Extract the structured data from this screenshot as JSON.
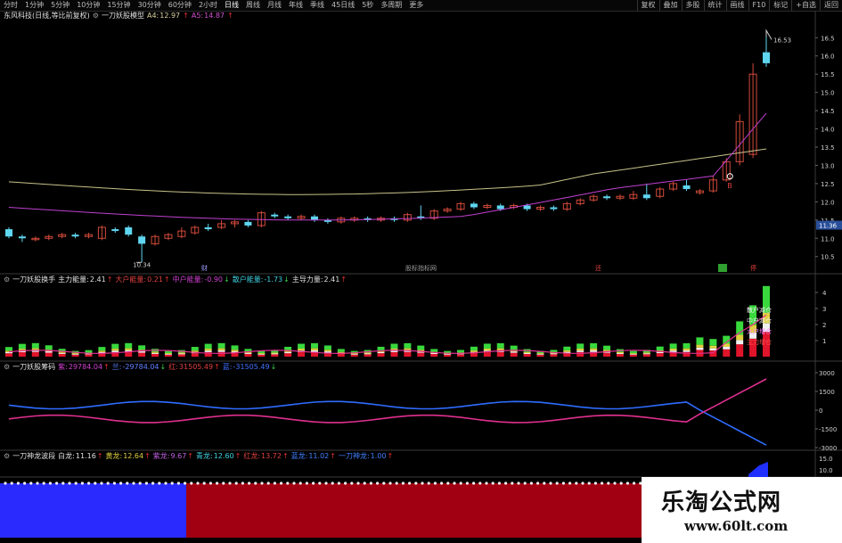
{
  "toolbar": {
    "tabs": [
      "分时",
      "1分钟",
      "5分钟",
      "10分钟",
      "15分钟",
      "30分钟",
      "60分钟",
      "2小时",
      "日线",
      "周线",
      "月线",
      "年线",
      "季线",
      "45日线",
      "5秒",
      "多周期",
      "更多"
    ],
    "active_tab": "日线",
    "right_buttons": [
      "复权",
      "叠加",
      "多股",
      "统计",
      "画线",
      "F10",
      "标记",
      "+自选",
      "返回"
    ]
  },
  "price_panel": {
    "stock": "东风科技(日线,等比前复权)",
    "indicator": "一刀妖股模型",
    "a4_label": "A4:",
    "a4_value": "12.97",
    "a5_label": "A5:",
    "a5_value": "14.87",
    "high_label": "16.53",
    "low_label": "10.34",
    "signal_label": "B",
    "center_caption": "股标指标网",
    "axis_ticks": [
      "16.5",
      "16.0",
      "15.5",
      "15.0",
      "14.5",
      "14.0",
      "13.5",
      "13.0",
      "12.5",
      "12.0",
      "11.5",
      "11.0",
      "10.5"
    ],
    "price_tag": "11.36",
    "bottom_marks": [
      "财",
      "财",
      "还",
      "停"
    ]
  },
  "energy_panel": {
    "name": "一刀妖股换手",
    "fields": [
      {
        "label": "主力能量:",
        "value": "2.41"
      },
      {
        "label": "大户能量:",
        "value": "0.21"
      },
      {
        "label": "中户能量:",
        "value": "-0.90"
      },
      {
        "label": "散户能量:",
        "value": "-1.73"
      },
      {
        "label": "主导力量:",
        "value": "2.41"
      }
    ],
    "legend": [
      "散户减仓",
      "中户减仓",
      "大户增仓",
      "主力增仓"
    ],
    "axis_ticks": [
      "4",
      "3",
      "2",
      "1"
    ]
  },
  "chip_panel": {
    "name": "一刀妖股筹码",
    "fields": [
      {
        "label": "紫:",
        "value": "29784.04"
      },
      {
        "label": "兰:",
        "value": "-29784.04"
      },
      {
        "label": "红:",
        "value": "31505.49"
      },
      {
        "label": "蓝:",
        "value": "-31505.49"
      }
    ],
    "axis_ticks": [
      "3000",
      "1500",
      "0",
      "-1500",
      "-3000"
    ]
  },
  "dragon_panel": {
    "name": "一刀神龙波段",
    "fields": [
      {
        "label": "白龙:",
        "value": "11.16"
      },
      {
        "label": "黄龙:",
        "value": "12.64"
      },
      {
        "label": "紫龙:",
        "value": "9.67"
      },
      {
        "label": "青龙:",
        "value": "12.60"
      },
      {
        "label": "红龙:",
        "value": "13.72"
      },
      {
        "label": "蓝龙:",
        "value": "11.02"
      },
      {
        "label": "一刀神龙:",
        "value": "1.00"
      }
    ],
    "axis_ticks": [
      "15.0",
      "10.0"
    ]
  },
  "watermark": {
    "line1": "乐淘公式网",
    "line2": "www.60lt.com"
  },
  "colors": {
    "up": "#d24a3a",
    "down": "#5fd6f0",
    "ma_yellow": "#c8c28a",
    "ma_purple": "#c040d0",
    "magenta": "#e0308f",
    "blue": "#2f6cff",
    "green": "#39d83c",
    "red": "#e0142a"
  }
}
